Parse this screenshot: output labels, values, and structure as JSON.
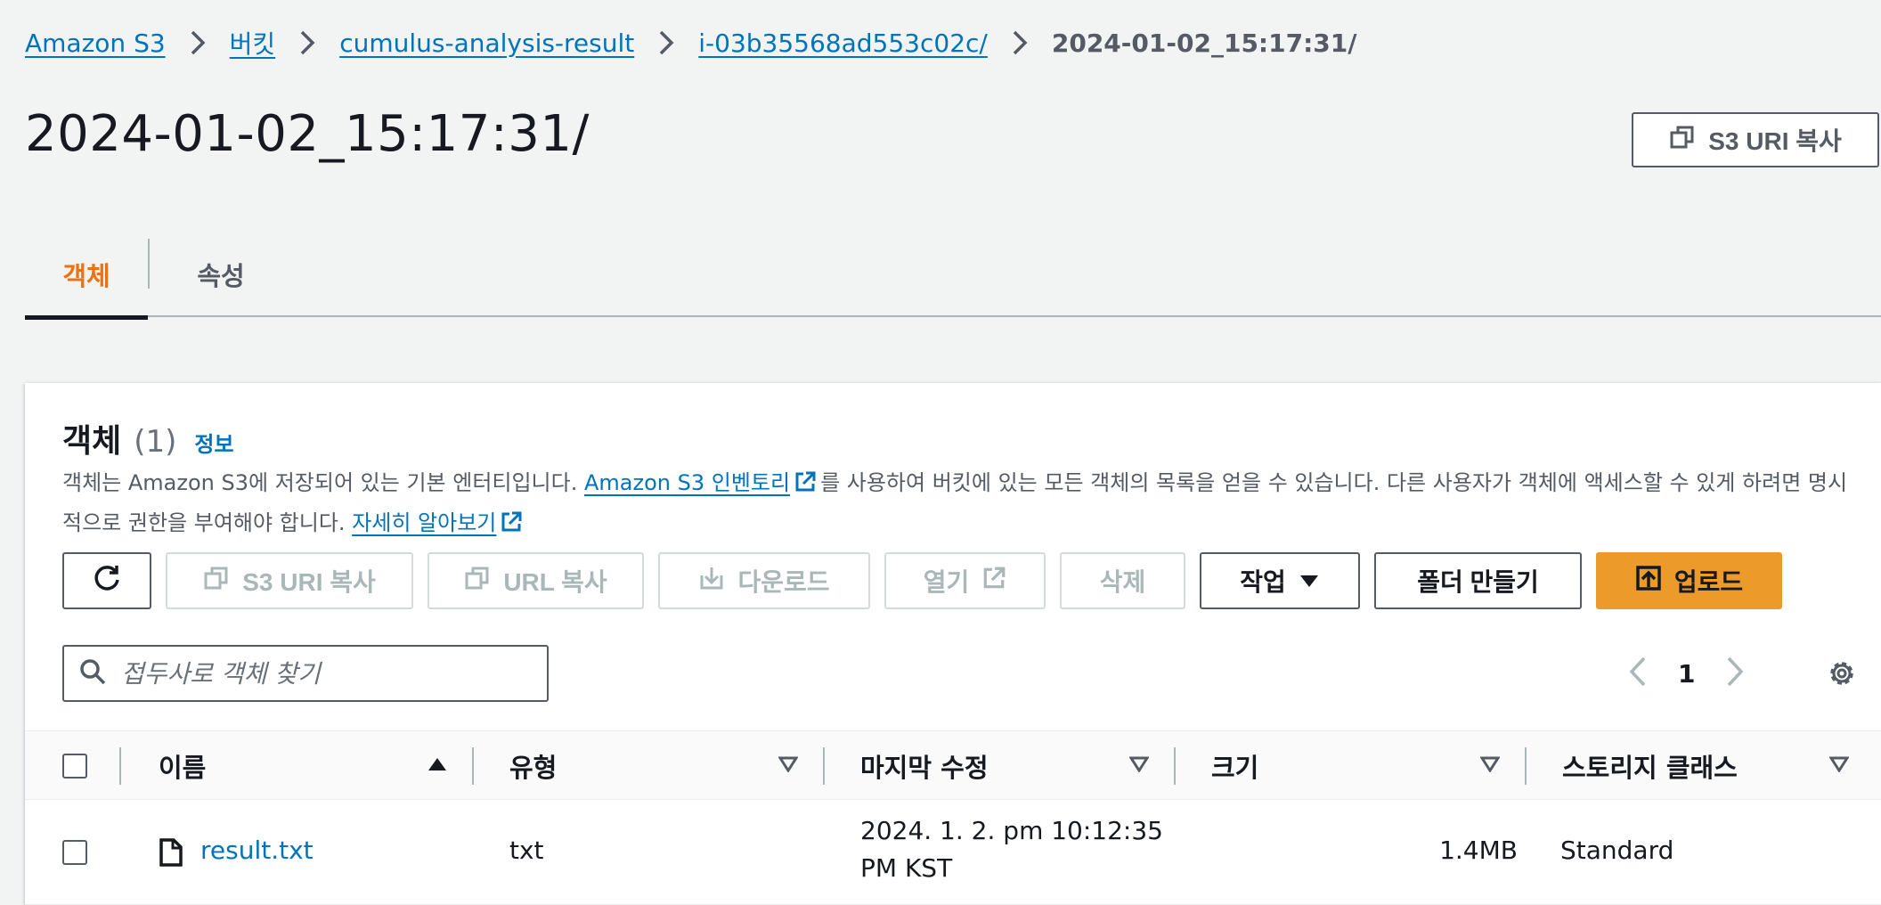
{
  "breadcrumb": {
    "items": [
      "Amazon S3",
      "버킷",
      "cumulus-analysis-result",
      "i-03b35568ad553c02c/"
    ],
    "current": "2024-01-02_15:17:31/"
  },
  "page": {
    "title": "2024-01-02_15:17:31/",
    "copy_uri_label": "S3 URI 복사"
  },
  "tabs": [
    {
      "label": "객체",
      "active": true
    },
    {
      "label": "속성",
      "active": false
    }
  ],
  "objects_panel": {
    "title": "객체",
    "count": "(1)",
    "info_label": "정보",
    "desc_part1": "객체는 Amazon S3에 저장되어 있는 기본 엔터티입니다. ",
    "inventory_link": "Amazon S3 인벤토리",
    "desc_part2": "를 사용하여 버킷에 있는 모든 객체의 목록을 얻을 수 있습니다. 다른 사용자가 객체에 액세스할 수 있게 하려면 명시적으로 권한을 부여해야 합니다. ",
    "learn_more_link": "자세히 알아보기"
  },
  "toolbar": {
    "copy_s3_uri": "S3 URI 복사",
    "copy_url": "URL 복사",
    "download": "다운로드",
    "open": "열기",
    "delete": "삭제",
    "actions": "작업",
    "create_folder": "폴더 만들기",
    "upload": "업로드"
  },
  "search": {
    "placeholder": "접두사로 객체 찾기"
  },
  "pagination": {
    "page": "1"
  },
  "table": {
    "columns": [
      "이름",
      "유형",
      "마지막 수정",
      "크기",
      "스토리지 클래스"
    ],
    "rows": [
      {
        "name": "result.txt",
        "type": "txt",
        "modified_line1": "2024. 1. 2. pm 10:12:35",
        "modified_line2": "PM KST",
        "size": "1.4MB",
        "storage_class": "Standard"
      }
    ]
  },
  "colors": {
    "link": "#0073bb",
    "tab_active": "#ec7211",
    "primary_button": "#ec9a29"
  }
}
